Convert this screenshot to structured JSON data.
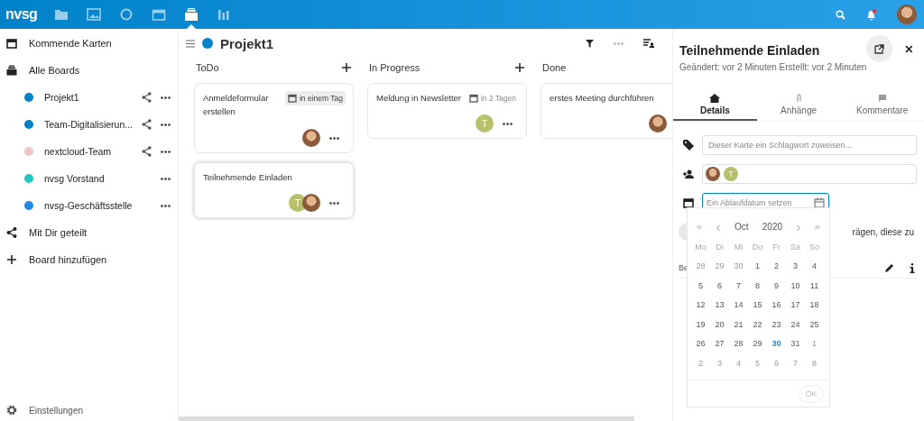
{
  "topbar": {
    "logo": "nvsg",
    "apps": [
      {
        "kind": "files",
        "selected": false
      },
      {
        "kind": "photos",
        "selected": false
      },
      {
        "kind": "talk",
        "selected": false
      },
      {
        "kind": "calendar",
        "selected": false
      },
      {
        "kind": "deck",
        "selected": true
      },
      {
        "kind": "analytics",
        "selected": false
      }
    ],
    "notification_dot": true
  },
  "sidebar": {
    "items": [
      {
        "kind": "upcoming",
        "label": "Kommende Karten"
      },
      {
        "kind": "boards",
        "label": "Alle Boards",
        "children": [
          {
            "label": "Projekt1",
            "color": "#0082c9",
            "shared": true
          },
          {
            "label": "Team-Digitalisierun...",
            "color": "#0082c9",
            "shared": true
          },
          {
            "label": "nextcloud-Team",
            "color": "#f0c5c5",
            "shared": true
          },
          {
            "label": "nvsg Vorstand",
            "color": "#1dc9c1",
            "shared": false
          },
          {
            "label": "nvsg-Geschäftsstelle",
            "color": "#1e88e5",
            "shared": false
          }
        ]
      },
      {
        "kind": "shared",
        "label": "Mit Dir geteilt"
      },
      {
        "kind": "add",
        "label": "Board hinzufügen"
      }
    ],
    "settings": "Einstellungen"
  },
  "board": {
    "title": "Projekt1",
    "color": "#0082c9",
    "stacks": [
      {
        "title": "ToDo",
        "can_add": true,
        "cards": [
          {
            "title": "Anmeldeformular erstellen",
            "due": "in einem Tag",
            "due_soon": true,
            "selected": false,
            "assignees": [
              {
                "kind": "photo"
              }
            ]
          },
          {
            "title": "Teilnehmende Einladen",
            "selected": true,
            "assignees": [
              {
                "kind": "initial",
                "initial": "T"
              },
              {
                "kind": "photo"
              }
            ]
          }
        ]
      },
      {
        "title": "In Progress",
        "can_add": true,
        "cards": [
          {
            "title": "Meldung in Newsletter",
            "due": "in 2 Tagen",
            "due_soon": false,
            "selected": false,
            "assignees": [
              {
                "kind": "initial",
                "initial": "T"
              }
            ]
          }
        ]
      },
      {
        "title": "Done",
        "cards": [
          {
            "title": "erstes Meeting durchführen",
            "selected": false,
            "assignees": [
              {
                "kind": "photo"
              }
            ]
          }
        ]
      }
    ]
  },
  "details": {
    "title": "Teilnehmende Einladen",
    "subtitle": "Geändert: vor 2 Minuten Erstellt: vor 2 Minuten",
    "tabs": [
      {
        "kind": "details",
        "label": "Details",
        "selected": true
      },
      {
        "kind": "attachments",
        "label": "Anhänge",
        "selected": false
      },
      {
        "kind": "comments",
        "label": "Kommentare",
        "selected": false
      }
    ],
    "tags": {
      "placeholder": "Dieser Karte ein Schlagwort zuweisen..."
    },
    "assignees": [
      {
        "kind": "photo"
      },
      {
        "kind": "initial",
        "initial": "T"
      }
    ],
    "due": {
      "placeholder": "Ein Ablaufdatum setzen"
    },
    "hidden_text": "rägen, diese zu",
    "description_label": "Be",
    "datepicker": {
      "prev_year": "«",
      "prev_month": "‹",
      "month": "Oct",
      "year": "2020",
      "next_month": "›",
      "next_year": "»",
      "weekdays": [
        "Mo",
        "Di",
        "Mi",
        "Do",
        "Fr",
        "Sa",
        "So"
      ],
      "days": [
        {
          "label": "28",
          "kind": "other"
        },
        {
          "label": "29",
          "kind": "other"
        },
        {
          "label": "30",
          "kind": "other"
        },
        {
          "label": "1",
          "kind": "current"
        },
        {
          "label": "2",
          "kind": "current"
        },
        {
          "label": "3",
          "kind": "current"
        },
        {
          "label": "4",
          "kind": "current"
        },
        {
          "label": "5",
          "kind": "current"
        },
        {
          "label": "6",
          "kind": "current"
        },
        {
          "label": "7",
          "kind": "current"
        },
        {
          "label": "8",
          "kind": "current"
        },
        {
          "label": "9",
          "kind": "current"
        },
        {
          "label": "10",
          "kind": "current"
        },
        {
          "label": "11",
          "kind": "current"
        },
        {
          "label": "12",
          "kind": "current"
        },
        {
          "label": "13",
          "kind": "current"
        },
        {
          "label": "14",
          "kind": "current"
        },
        {
          "label": "15",
          "kind": "current"
        },
        {
          "label": "16",
          "kind": "current"
        },
        {
          "label": "17",
          "kind": "current"
        },
        {
          "label": "18",
          "kind": "current"
        },
        {
          "label": "19",
          "kind": "current"
        },
        {
          "label": "20",
          "kind": "current"
        },
        {
          "label": "21",
          "kind": "current"
        },
        {
          "label": "22",
          "kind": "current"
        },
        {
          "label": "23",
          "kind": "current"
        },
        {
          "label": "24",
          "kind": "current"
        },
        {
          "label": "25",
          "kind": "current"
        },
        {
          "label": "26",
          "kind": "current"
        },
        {
          "label": "27",
          "kind": "current"
        },
        {
          "label": "28",
          "kind": "current"
        },
        {
          "label": "29",
          "kind": "current"
        },
        {
          "label": "30",
          "kind": "today"
        },
        {
          "label": "31",
          "kind": "current"
        },
        {
          "label": "1",
          "kind": "other"
        },
        {
          "label": "2",
          "kind": "other"
        },
        {
          "label": "3",
          "kind": "other"
        },
        {
          "label": "4",
          "kind": "other"
        },
        {
          "label": "5",
          "kind": "other"
        },
        {
          "label": "6",
          "kind": "other"
        },
        {
          "label": "7",
          "kind": "other"
        },
        {
          "label": "8",
          "kind": "other"
        }
      ],
      "ok": {
        "label": "OK",
        "disabled": true
      }
    }
  }
}
